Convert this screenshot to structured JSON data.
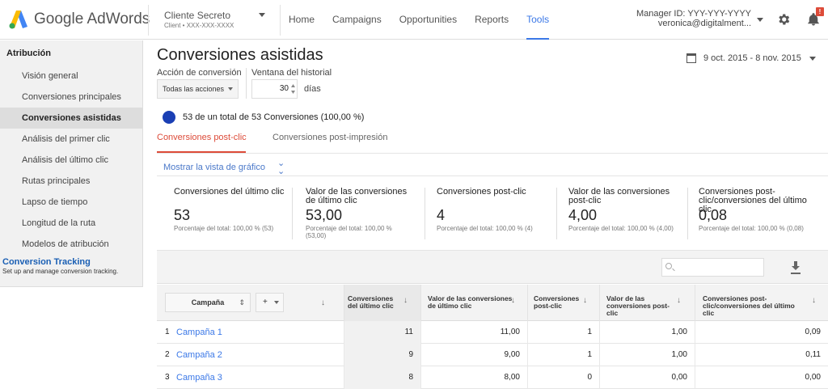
{
  "header": {
    "logo_text": "Google AdWords",
    "client_name": "Cliente Secreto",
    "client_id": "Client  •  XXX-XXX-XXXX",
    "nav": [
      "Home",
      "Campaigns",
      "Opportunities",
      "Reports",
      "Tools"
    ],
    "active_nav": "Tools",
    "manager_id": "Manager ID: YYY-YYY-YYYY",
    "manager_email": "veronica@digitalment...",
    "notification_badge": "!"
  },
  "sidebar": {
    "heading": "Atribución",
    "items": [
      "Visión general",
      "Conversiones principales",
      "Conversiones asistidas",
      "Análisis del primer clic",
      "Análisis del último clic",
      "Rutas principales",
      "Lapso de tiempo",
      "Longitud de la ruta",
      "Modelos de atribución"
    ],
    "active_item": "Conversiones asistidas",
    "conversion_tracking_title": "Conversion Tracking",
    "conversion_tracking_desc": "Set up and manage conversion tracking."
  },
  "main": {
    "title": "Conversiones asistidas",
    "date_range": "9 oct. 2015 - 8 nov. 2015",
    "action_label": "Acción de conversión",
    "action_value": "Todas las acciones",
    "window_label": "Ventana del historial",
    "window_value": "30",
    "window_unit": "días",
    "summary": "53 de un total de 53 Conversiones (100,00 %)",
    "tabs": [
      "Conversiones post-clic",
      "Conversiones post-impresión"
    ],
    "show_graph": "Mostrar la vista de gráfico"
  },
  "metrics": [
    {
      "label": "Conversiones del último clic",
      "value": "53",
      "pct": "Porcentaje del total: 100,00 % (53)"
    },
    {
      "label": "Valor de las conversiones de último clic",
      "value": "53,00",
      "pct": "Porcentaje del total: 100,00 % (53,00)"
    },
    {
      "label": "Conversiones post-clic",
      "value": "4",
      "pct": "Porcentaje del total: 100,00 % (4)"
    },
    {
      "label": "Valor de las conversiones post-clic",
      "value": "4,00",
      "pct": "Porcentaje del total: 100,00 % (4,00)"
    },
    {
      "label": "Conversiones post-clic/conversiones del último clic",
      "value": "0,08",
      "pct": "Porcentaje del total: 100,00 % (0,08)"
    }
  ],
  "table": {
    "campaign_header": "Campaña",
    "add_label": "+",
    "columns": [
      "Conversiones del último clic",
      "Valor de las conversiones de último clic",
      "Conversiones post-clic",
      "Valor de las conversiones post-clic",
      "Conversiones post-clic/conversiones del último clic"
    ],
    "rows": [
      {
        "num": "1",
        "name": "Campaña 1",
        "values": [
          "11",
          "11,00",
          "1",
          "1,00",
          "0,09"
        ]
      },
      {
        "num": "2",
        "name": "Campaña 2",
        "values": [
          "9",
          "9,00",
          "1",
          "1,00",
          "0,11"
        ]
      },
      {
        "num": "3",
        "name": "Campaña 3",
        "values": [
          "8",
          "8,00",
          "0",
          "0,00",
          "0,00"
        ]
      }
    ]
  },
  "colors": {
    "accent_blue": "#3b78e7",
    "active_tab_red": "#dd4b39",
    "sidebar_bg": "#f1f1f1"
  }
}
